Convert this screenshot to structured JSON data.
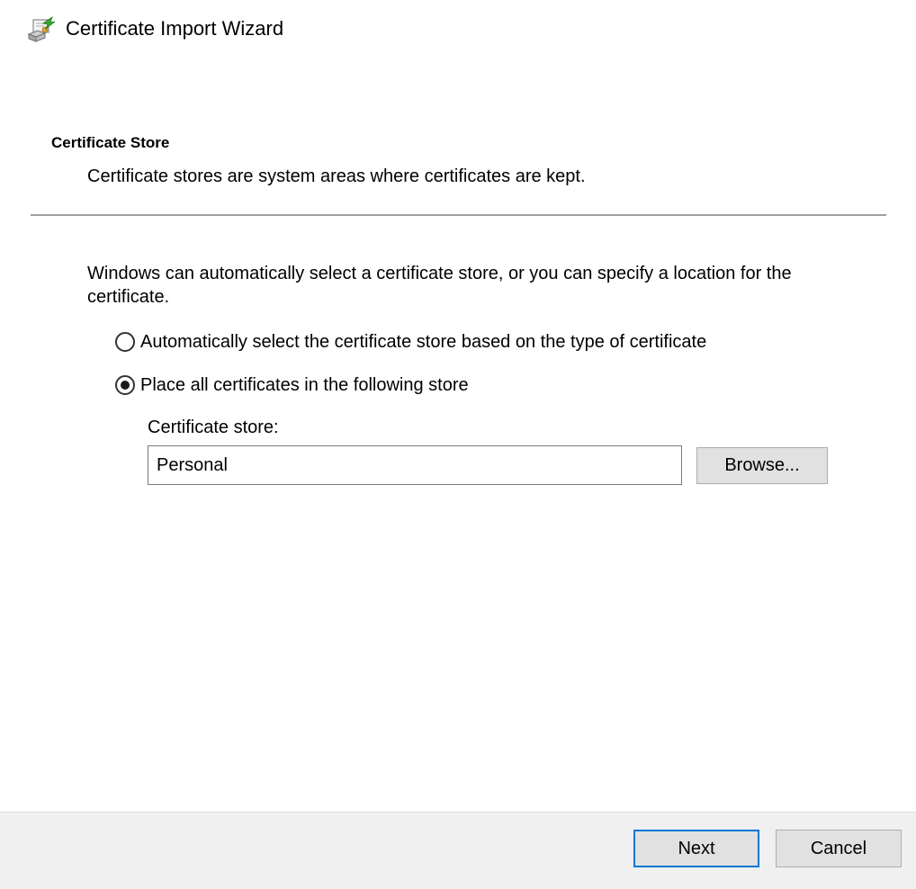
{
  "window": {
    "title": "Certificate Import Wizard",
    "icon": "certificate-wizard-icon"
  },
  "page": {
    "heading": "Certificate Store",
    "description": "Certificate stores are system areas where certificates are kept.",
    "intro": "Windows can automatically select a certificate store, or you can specify a location for the certificate."
  },
  "options": {
    "auto": {
      "label": "Automatically select the certificate store based on the type of certificate",
      "selected": false
    },
    "manual": {
      "label": "Place all certificates in the following store",
      "selected": true
    }
  },
  "store": {
    "label": "Certificate store:",
    "value": "Personal",
    "browse_label": "Browse..."
  },
  "footer": {
    "next_label": "Next",
    "cancel_label": "Cancel"
  },
  "colors": {
    "footer_background": "#f0f0f0",
    "default_button_border": "#0078d7",
    "button_face": "#e1e1e1"
  }
}
